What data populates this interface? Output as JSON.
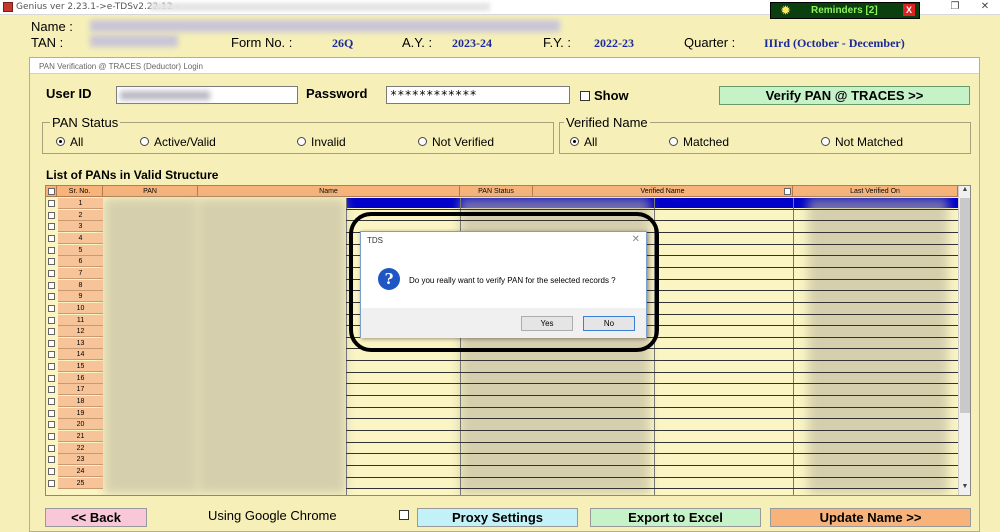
{
  "window": {
    "title": "Genius ver 2.23.1->e-TDSv2.22.12 -",
    "reminders_label": "Reminders [2]",
    "reminders_close": "X",
    "restore_icon": "restore-icon",
    "close_icon": "close-icon"
  },
  "header": {
    "name_label": "Name :",
    "tan_label": "TAN :",
    "form_no_label": "Form No. :",
    "form_no": "26Q",
    "ay_label": "A.Y. :",
    "ay": "2023-24",
    "fy_label": "F.Y. :",
    "fy": "2022-23",
    "quarter_label": "Quarter :",
    "quarter": "IIIrd (October - December)"
  },
  "panel": {
    "title": "PAN Verification @ TRACES (Deductor) Login",
    "user_id_label": "User ID",
    "user_id_value": "",
    "password_label": "Password",
    "password_value": "************",
    "show_label": "Show",
    "verify_button": "Verify PAN @ TRACES >>"
  },
  "pan_status": {
    "title": "PAN Status",
    "options": [
      "All",
      "Active/Valid",
      "Invalid",
      "Not Verified"
    ],
    "selected": "All"
  },
  "verified_name": {
    "title": "Verified Name",
    "options": [
      "All",
      "Matched",
      "Not Matched"
    ],
    "selected": "All"
  },
  "list": {
    "title": "List of PANs in Valid Structure",
    "columns": [
      "Sr. No.",
      "PAN",
      "Name",
      "PAN Status",
      "Verified Name",
      "Last Verified On"
    ],
    "rows": [
      "1",
      "2",
      "3",
      "4",
      "5",
      "6",
      "7",
      "8",
      "9",
      "10",
      "11",
      "12",
      "13",
      "14",
      "15",
      "16",
      "17",
      "18",
      "19",
      "20",
      "21",
      "22",
      "23",
      "24",
      "25"
    ]
  },
  "dialog": {
    "title": "TDS",
    "message": "Do you really want to verify PAN for the selected records ?",
    "yes": "Yes",
    "no": "No",
    "icon": "question-icon"
  },
  "bottom": {
    "back": "<< Back",
    "browser_text": "Using Google Chrome",
    "proxy": "Proxy Settings",
    "export": "Export to Excel",
    "update": "Update Name >>"
  },
  "colors": {
    "background": "#f6f0b8",
    "header_value": "#1b2a9a",
    "grid_header": "#f7b37a",
    "green_button": "#c6f2c8",
    "pink_button": "#f8c8d8",
    "cyan_button": "#c2f2f8",
    "orange_button": "#f7b37a"
  }
}
